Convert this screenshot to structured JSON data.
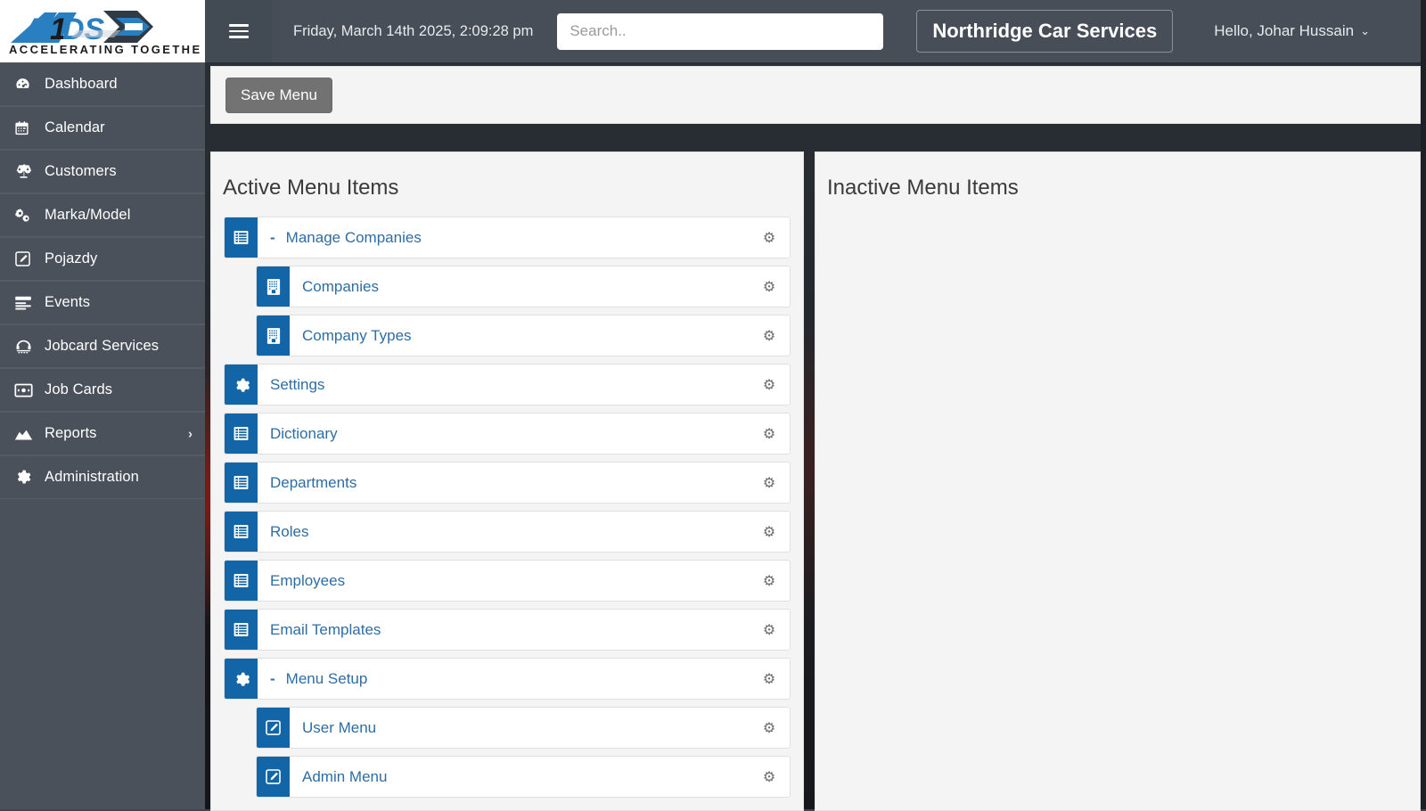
{
  "brand": {
    "logo_text": "ADS",
    "logo_tagline": "ACCELERATING TOGETHER",
    "accent_blue": "#1266a8",
    "link_blue": "#2e6da4",
    "sidebar_bg": "#4a515b",
    "header_bg": "#474e58"
  },
  "header": {
    "menu_toggle_name": "hamburger-icon",
    "datetime": "Friday, March 14th 2025, 2:09:28 pm",
    "search": {
      "value": "",
      "placeholder": "Search.."
    },
    "company": "Northridge Car Services",
    "user_greeting": "Hello, Johar Hussain",
    "user_caret": "⌄"
  },
  "sidebar": {
    "items": [
      {
        "label": "Dashboard",
        "icon": "dashboard-icon",
        "has_caret": false
      },
      {
        "label": "Calendar",
        "icon": "calendar-icon",
        "has_caret": false
      },
      {
        "label": "Customers",
        "icon": "balance-scale-icon",
        "has_caret": false
      },
      {
        "label": "Marka/Model",
        "icon": "cogs-icon",
        "has_caret": false
      },
      {
        "label": "Pojazdy",
        "icon": "edit-square-icon",
        "has_caret": false
      },
      {
        "label": "Events",
        "icon": "list-bars-icon",
        "has_caret": false
      },
      {
        "label": "Jobcard Services",
        "icon": "service-desk-icon",
        "has_caret": false
      },
      {
        "label": "Job Cards",
        "icon": "id-card-icon",
        "has_caret": false
      },
      {
        "label": "Reports",
        "icon": "chart-area-icon",
        "has_caret": true,
        "caret": "›"
      },
      {
        "label": "Administration",
        "icon": "gear-icon",
        "has_caret": false
      }
    ]
  },
  "toolbar": {
    "save_label": "Save Menu"
  },
  "main": {
    "active_panel_title": "Active Menu Items",
    "inactive_panel_title": "Inactive Menu Items",
    "gear_glyph": "⚙",
    "collapse_dash": "-",
    "active_items": [
      {
        "label": "Manage Companies",
        "level": 1,
        "icon": "list-table-icon",
        "dash": "-",
        "gear": "⚙"
      },
      {
        "label": "Companies",
        "level": 2,
        "icon": "building-icon",
        "dash": "",
        "gear": "⚙"
      },
      {
        "label": "Company Types",
        "level": 2,
        "icon": "building-icon",
        "dash": "",
        "gear": "⚙"
      },
      {
        "label": "Settings",
        "level": 1,
        "icon": "gear-icon",
        "dash": "",
        "gear": "⚙"
      },
      {
        "label": "Dictionary",
        "level": 1,
        "icon": "list-table-icon",
        "dash": "",
        "gear": "⚙"
      },
      {
        "label": "Departments",
        "level": 1,
        "icon": "list-table-icon",
        "dash": "",
        "gear": "⚙"
      },
      {
        "label": "Roles",
        "level": 1,
        "icon": "list-table-icon",
        "dash": "",
        "gear": "⚙"
      },
      {
        "label": "Employees",
        "level": 1,
        "icon": "list-table-icon",
        "dash": "",
        "gear": "⚙"
      },
      {
        "label": "Email Templates",
        "level": 1,
        "icon": "list-table-icon",
        "dash": "",
        "gear": "⚙"
      },
      {
        "label": "Menu Setup",
        "level": 1,
        "icon": "gear-icon",
        "dash": "-",
        "gear": "⚙"
      },
      {
        "label": "User Menu",
        "level": 2,
        "icon": "edit-square-icon",
        "dash": "",
        "gear": "⚙"
      },
      {
        "label": "Admin Menu",
        "level": 2,
        "icon": "edit-square-icon",
        "dash": "",
        "gear": "⚙"
      }
    ],
    "inactive_items": []
  }
}
